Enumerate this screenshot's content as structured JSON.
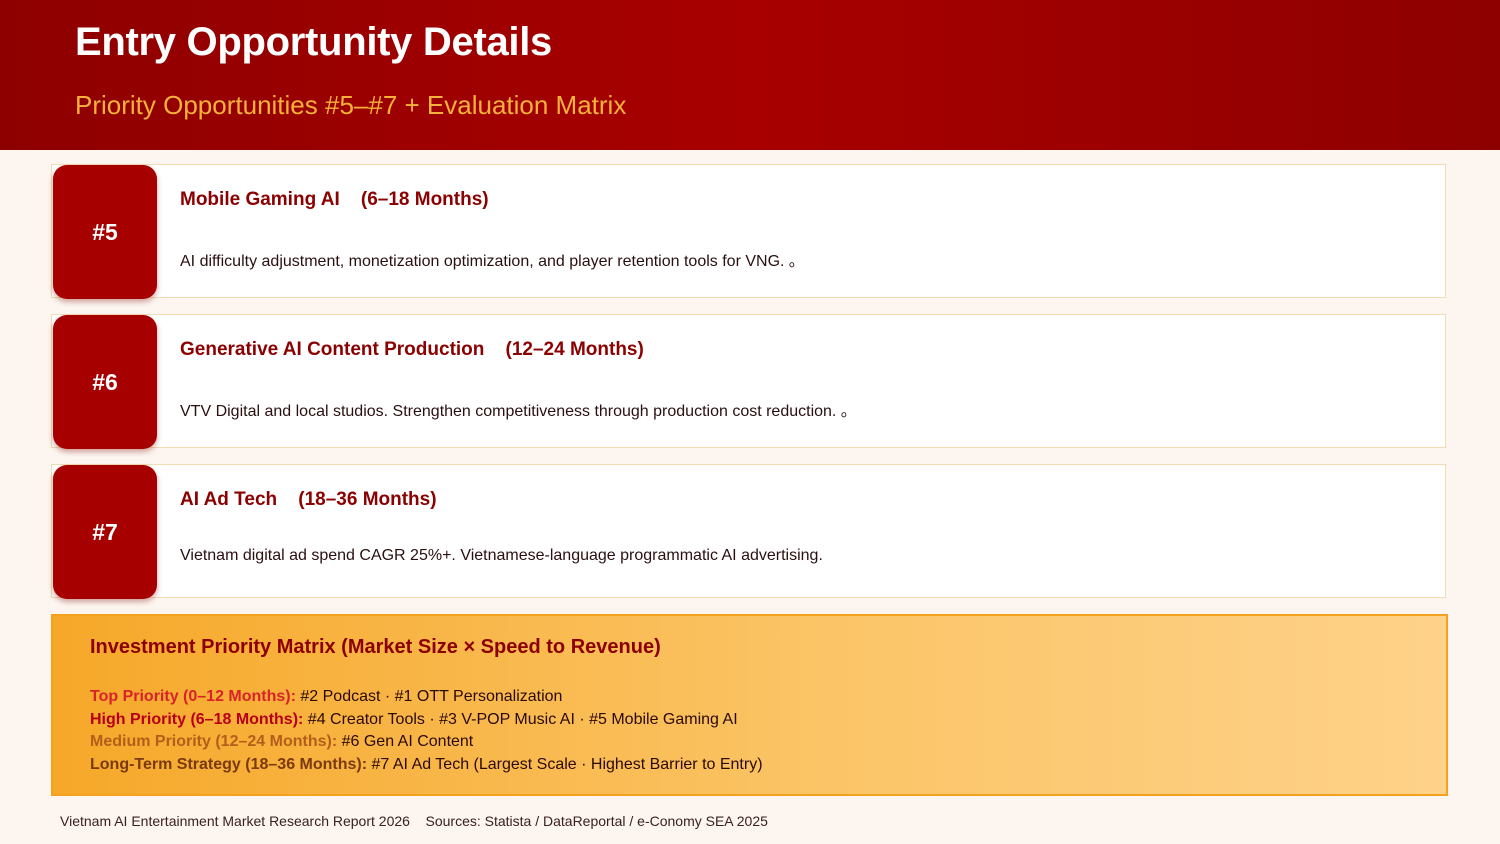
{
  "header": {
    "title": "Entry Opportunity Details",
    "subtitle": "Priority Opportunities #5–#7 + Evaluation Matrix"
  },
  "opportunities": [
    {
      "badge": "#5",
      "title": "Mobile Gaming AI",
      "timeline": "(6–18 Months)",
      "description": "AI difficulty adjustment, monetization optimization, and player retention tools for VNG. ｡"
    },
    {
      "badge": "#6",
      "title": "Generative AI Content Production",
      "timeline": "(12–24 Months)",
      "description": "VTV Digital and local studios. Strengthen competitiveness through production cost reduction. ｡"
    },
    {
      "badge": "#7",
      "title": "AI Ad Tech",
      "timeline": "(18–36 Months)",
      "description": "Vietnam digital ad spend CAGR 25%+. Vietnamese-language programmatic AI advertising."
    }
  ],
  "matrix": {
    "title": "Investment Priority Matrix (Market Size × Speed to Revenue)",
    "rows": [
      {
        "label": "Top Priority (0–12 Months):",
        "value": " #2 Podcast · #1 OTT Personalization"
      },
      {
        "label": "High Priority (6–18 Months):",
        "value": " #4 Creator Tools · #3 V-POP Music AI · #5 Mobile Gaming AI"
      },
      {
        "label": "Medium Priority (12–24 Months):",
        "value": " #6 Gen AI Content"
      },
      {
        "label": "Long-Term Strategy (18–36 Months):",
        "value": " #7 AI Ad Tech (Largest Scale · Highest Barrier to Entry)"
      }
    ]
  },
  "footer": {
    "report": "Vietnam AI Entertainment Market Research Report 2026",
    "sources": "Sources: Statista / DataReportal / e-Conomy SEA 2025"
  }
}
